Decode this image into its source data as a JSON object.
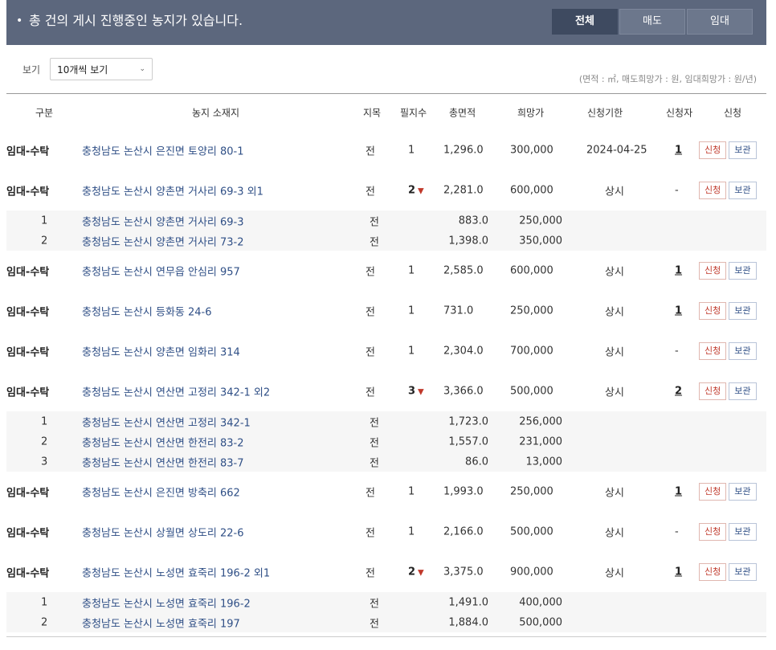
{
  "banner": {
    "bullet": "•",
    "title": "총 건의 게시 진행중인 농지가 있습니다.",
    "tabs": [
      {
        "label": "전체",
        "active": true
      },
      {
        "label": "매도",
        "active": false
      },
      {
        "label": "임대",
        "active": false
      }
    ]
  },
  "view": {
    "label": "보기",
    "selected": "10개씩 보기",
    "chevron": "⌄"
  },
  "unit_note": "(면적 : ㎡, 매도희망가 : 원, 임대희망가 : 원/년)",
  "table": {
    "headers": {
      "type": "구분",
      "address": "농지 소재지",
      "jimok": "지목",
      "count": "필지수",
      "area": "총면적",
      "price": "희망가",
      "deadline": "신청기한",
      "applicants": "신청자",
      "apply": "신청"
    },
    "apply_label": "신청",
    "keep_label": "보관",
    "caret": "▼",
    "rows": [
      {
        "type": "임대-수탁",
        "address": "충청남도 논산시 은진면 토양리 80-1",
        "jimok": "전",
        "count": "1",
        "area": "1,296.0",
        "price": "300,000",
        "deadline": "2024-04-25",
        "applicants": "1"
      },
      {
        "type": "임대-수탁",
        "address": "충청남도 논산시 양촌면 거사리 69-3 외1",
        "jimok": "전",
        "count": "2",
        "area": "2,281.0",
        "price": "600,000",
        "deadline": "상시",
        "applicants": "-",
        "parcels": [
          {
            "no": "1",
            "address": "충청남도 논산시 양촌면 거사리 69-3",
            "jimok": "전",
            "area": "883.0",
            "price": "250,000"
          },
          {
            "no": "2",
            "address": "충청남도 논산시 양촌면 거사리 73-2",
            "jimok": "전",
            "area": "1,398.0",
            "price": "350,000"
          }
        ]
      },
      {
        "type": "임대-수탁",
        "address": "충청남도 논산시 연무읍 안심리 957",
        "jimok": "전",
        "count": "1",
        "area": "2,585.0",
        "price": "600,000",
        "deadline": "상시",
        "applicants": "1"
      },
      {
        "type": "임대-수탁",
        "address": "충청남도 논산시 등화동 24-6",
        "jimok": "전",
        "count": "1",
        "area": "731.0",
        "price": "250,000",
        "deadline": "상시",
        "applicants": "1"
      },
      {
        "type": "임대-수탁",
        "address": "충청남도 논산시 양촌면 임화리 314",
        "jimok": "전",
        "count": "1",
        "area": "2,304.0",
        "price": "700,000",
        "deadline": "상시",
        "applicants": "-"
      },
      {
        "type": "임대-수탁",
        "address": "충청남도 논산시 연산면 고정리 342-1 외2",
        "jimok": "전",
        "count": "3",
        "area": "3,366.0",
        "price": "500,000",
        "deadline": "상시",
        "applicants": "2",
        "parcels": [
          {
            "no": "1",
            "address": "충청남도 논산시 연산면 고정리 342-1",
            "jimok": "전",
            "area": "1,723.0",
            "price": "256,000"
          },
          {
            "no": "2",
            "address": "충청남도 논산시 연산면 한전리 83-2",
            "jimok": "전",
            "area": "1,557.0",
            "price": "231,000"
          },
          {
            "no": "3",
            "address": "충청남도 논산시 연산면 한전리 83-7",
            "jimok": "전",
            "area": "86.0",
            "price": "13,000"
          }
        ]
      },
      {
        "type": "임대-수탁",
        "address": "충청남도 논산시 은진면 방축리 662",
        "jimok": "전",
        "count": "1",
        "area": "1,993.0",
        "price": "250,000",
        "deadline": "상시",
        "applicants": "1"
      },
      {
        "type": "임대-수탁",
        "address": "충청남도 논산시 상월면 상도리 22-6",
        "jimok": "전",
        "count": "1",
        "area": "2,166.0",
        "price": "500,000",
        "deadline": "상시",
        "applicants": "-"
      },
      {
        "type": "임대-수탁",
        "address": "충청남도 논산시 노성면 효죽리 196-2 외1",
        "jimok": "전",
        "count": "2",
        "area": "3,375.0",
        "price": "900,000",
        "deadline": "상시",
        "applicants": "1",
        "parcels": [
          {
            "no": "1",
            "address": "충청남도 논산시 노성면 효죽리 196-2",
            "jimok": "전",
            "area": "1,491.0",
            "price": "400,000"
          },
          {
            "no": "2",
            "address": "충청남도 논산시 노성면 효죽리 197",
            "jimok": "전",
            "area": "1,884.0",
            "price": "500,000"
          }
        ]
      }
    ]
  }
}
